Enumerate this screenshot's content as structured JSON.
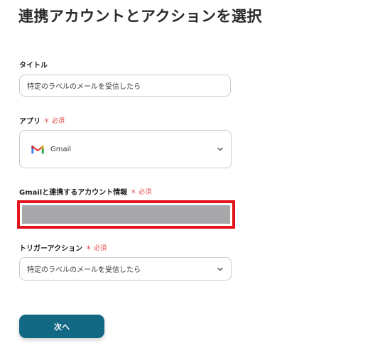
{
  "page": {
    "title": "連携アカウントとアクションを選択"
  },
  "fields": {
    "title": {
      "label": "タイトル",
      "value": "特定のラベルのメールを受信したら"
    },
    "app": {
      "label": "アプリ",
      "required_mark": "＊ 必須",
      "value": "Gmail",
      "icon": "gmail-icon"
    },
    "account": {
      "label": "Gmailと連携するアカウント情報",
      "required_mark": "＊ 必須",
      "redacted": true
    },
    "trigger": {
      "label": "トリガーアクション",
      "required_mark": "＊ 必須",
      "value": "特定のラベルのメールを受信したら"
    }
  },
  "actions": {
    "next_label": "次へ"
  },
  "colors": {
    "primary_button": "#136984",
    "required": "#e5484d",
    "redaction_border": "#e3141b",
    "redaction_fill": "#a7a7a9",
    "input_border": "#c7ccd1"
  }
}
